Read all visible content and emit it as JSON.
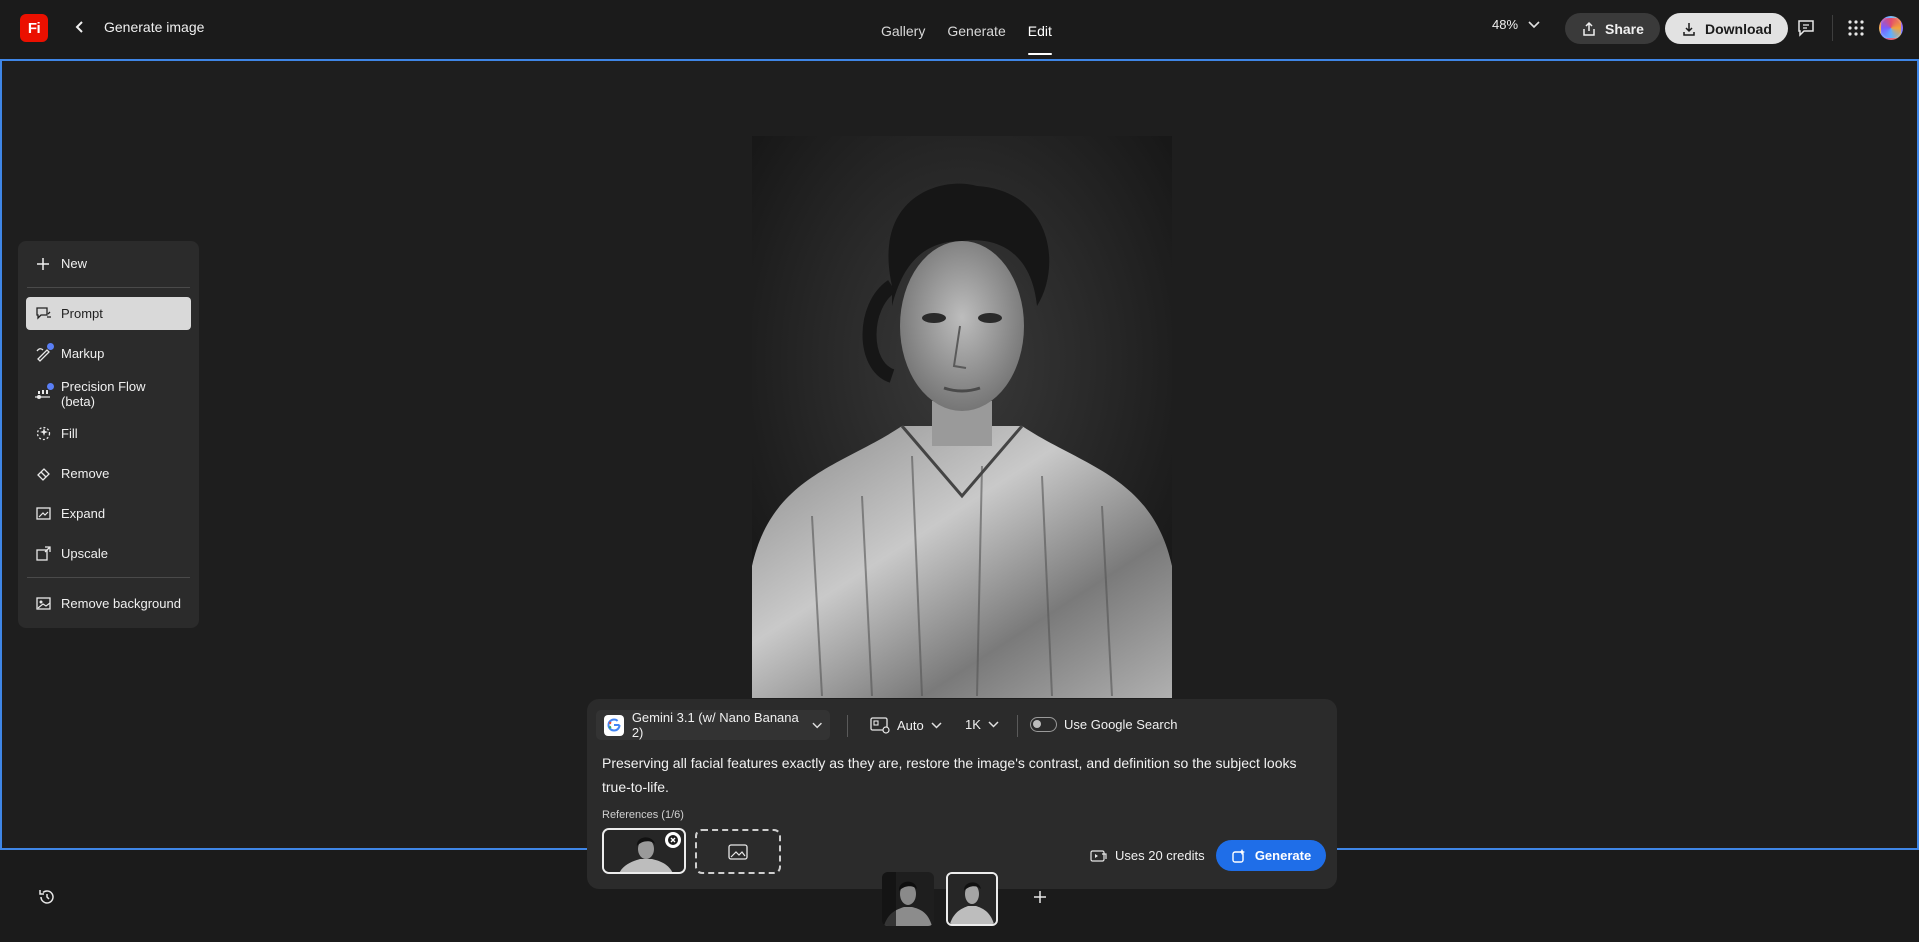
{
  "app": {
    "logo_text": "Fi",
    "title": "Generate image"
  },
  "nav": {
    "tabs": [
      "Gallery",
      "Generate",
      "Edit"
    ],
    "active": "Edit"
  },
  "header": {
    "zoom": "48%",
    "share_label": "Share",
    "download_label": "Download"
  },
  "tools": {
    "new_label": "New",
    "items": [
      {
        "label": "Prompt",
        "icon": "prompt-icon",
        "active": true
      },
      {
        "label": "Markup",
        "icon": "markup-icon",
        "badge": true
      },
      {
        "label": "Precision Flow (beta)",
        "icon": "precision-flow-icon",
        "badge": true
      },
      {
        "label": "Fill",
        "icon": "fill-icon"
      },
      {
        "label": "Remove",
        "icon": "remove-icon"
      },
      {
        "label": "Expand",
        "icon": "expand-icon"
      },
      {
        "label": "Upscale",
        "icon": "upscale-icon"
      }
    ],
    "remove_bg_label": "Remove background"
  },
  "prompt_panel": {
    "model": "Gemini 3.1 (w/ Nano Banana 2)",
    "aspect": "Auto",
    "resolution": "1K",
    "google_search_label": "Use Google Search",
    "google_search_enabled": false,
    "prompt": "Preserving all facial features exactly as they are, restore the image's contrast, and definition so the subject looks true-to-life.",
    "references_label": "References (1/6)",
    "credits_label": "Uses 20 credits",
    "generate_label": "Generate"
  },
  "colors": {
    "accent": "#1f6ee8",
    "selection": "#3f86e6",
    "brand": "#eb1000",
    "badge": "#5a7ff5"
  }
}
